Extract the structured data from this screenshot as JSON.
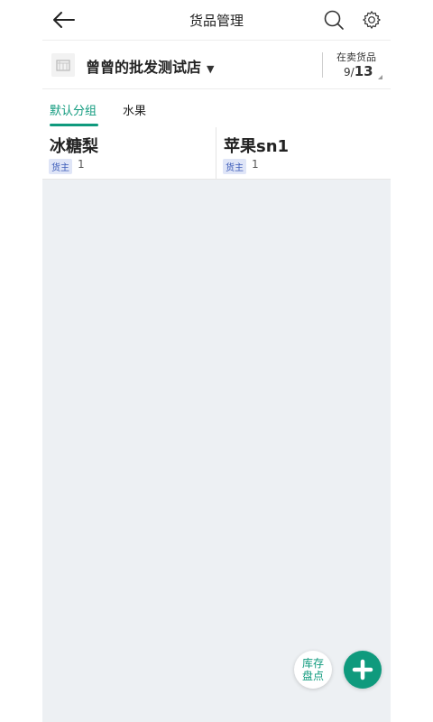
{
  "header": {
    "title": "货品管理",
    "icons": [
      "back-arrow-icon",
      "search-icon",
      "gear-icon"
    ]
  },
  "shop": {
    "name": "曾曾的批发测试店",
    "dropdown": "▼",
    "onsale_label": "在卖货品",
    "onsale_current": "9/",
    "onsale_total": "13"
  },
  "tabs": [
    {
      "label": "默认分组",
      "active": true
    },
    {
      "label": "水果",
      "active": false
    }
  ],
  "products": [
    {
      "name": "冰糖梨",
      "badge": "货主",
      "qty": "1"
    },
    {
      "name": "苹果sn1",
      "badge": "货主",
      "qty": "1"
    }
  ],
  "fab": {
    "stocktake_line1": "库存",
    "stocktake_line2": "盘点",
    "add_icon": "plus-icon"
  },
  "colors": {
    "accent": "#0f9a7d",
    "background": "#edf0f3",
    "badge_bg": "#dfe5f7",
    "badge_text": "#3b5bb8"
  }
}
